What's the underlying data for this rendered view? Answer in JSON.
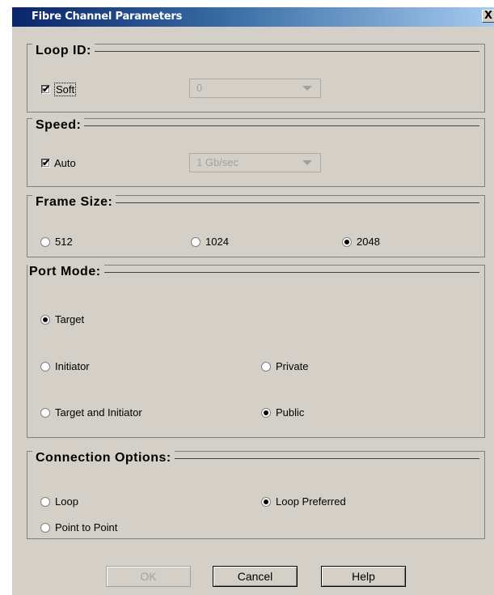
{
  "window": {
    "title": "Fibre Channel Parameters",
    "close_label": "X"
  },
  "loop_id": {
    "legend": "Loop ID:",
    "soft_label": "Soft",
    "soft_checked": true,
    "combo_value": "0"
  },
  "speed": {
    "legend": "Speed:",
    "auto_label": "Auto",
    "auto_checked": true,
    "combo_value": "1 Gb/sec"
  },
  "frame_size": {
    "legend": "Frame Size:",
    "options": [
      "512",
      "1024",
      "2048"
    ],
    "selected": "2048"
  },
  "port_mode": {
    "legend": "Port Mode:",
    "target": "Target",
    "initiator": "Initiator",
    "target_and_initiator": "Target and Initiator",
    "private": "Private",
    "public": "Public",
    "selected_mode": "Target",
    "selected_visibility": "Public"
  },
  "connection": {
    "legend": "Connection Options:",
    "loop": "Loop",
    "point_to_point": "Point to Point",
    "loop_preferred": "Loop Preferred",
    "selected": "Loop Preferred"
  },
  "buttons": {
    "ok": "OK",
    "cancel": "Cancel",
    "help": "Help"
  }
}
